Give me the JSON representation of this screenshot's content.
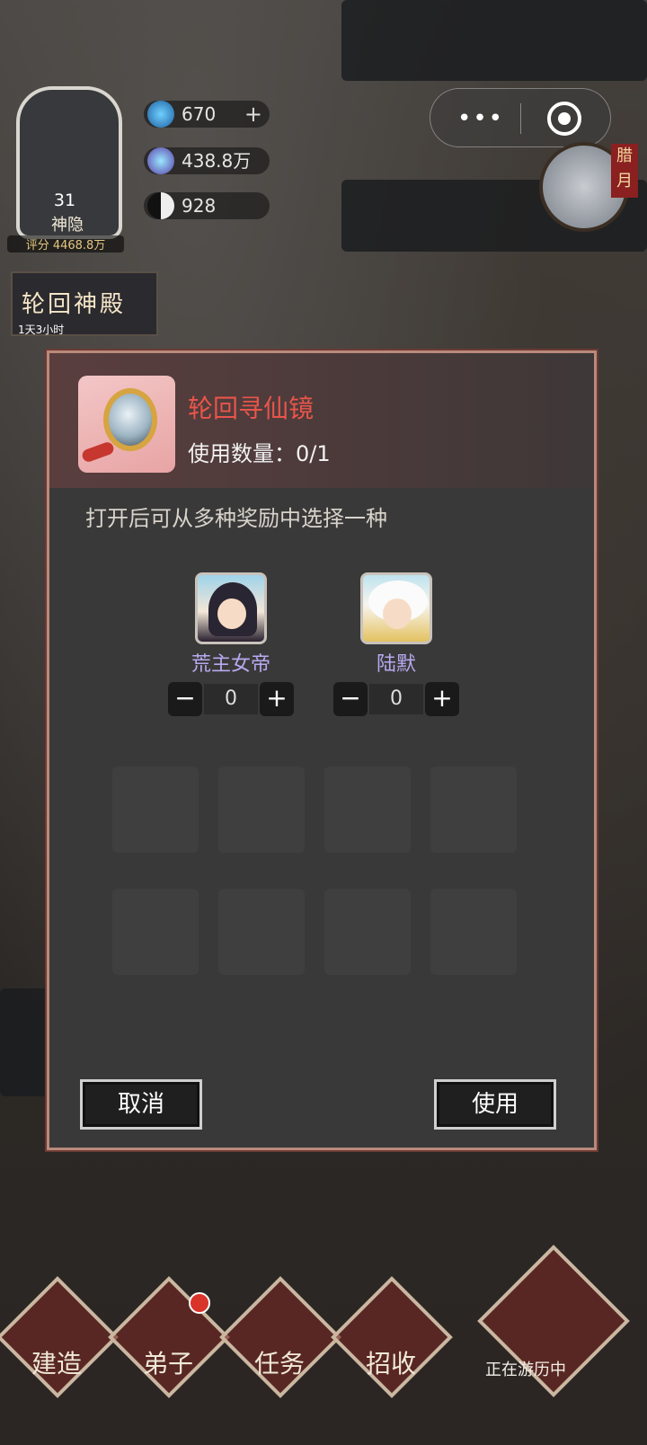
{
  "hud": {
    "avatar_level": "31",
    "avatar_name": "神隐",
    "avatar_score": "评分 4468.8万",
    "resources": [
      {
        "icon": "gem-icon",
        "value": "670",
        "has_plus": true
      },
      {
        "icon": "spirit-orb-icon",
        "value": "438.8万",
        "has_plus": false
      },
      {
        "icon": "yin-yang-icon",
        "value": "928",
        "has_plus": false
      }
    ],
    "hall_button_title": "轮回神殿",
    "hall_button_timer": "1天3小时",
    "month_tag": "腊月"
  },
  "dialog": {
    "item_name": "轮回寻仙镜",
    "use_count": "使用数量：0/1",
    "description": "打开后可从多种奖励中选择一种",
    "options": [
      {
        "name": "荒主女帝",
        "quantity": "0"
      },
      {
        "name": "陆默",
        "quantity": "0"
      }
    ],
    "stepper_minus": "−",
    "stepper_plus": "+",
    "cancel_label": "取消",
    "use_label": "使用"
  },
  "nav": {
    "items": [
      {
        "label": "建造",
        "badge": false
      },
      {
        "label": "弟子",
        "badge": true
      },
      {
        "label": "任务",
        "badge": false
      },
      {
        "label": "招收",
        "badge": false
      }
    ],
    "travel_status": "正在游历中"
  },
  "colors": {
    "item_name": "#e8554a",
    "option_name": "#b7aaf0",
    "dialog_bg": "#3a3939",
    "dialog_border": "#b98a7c"
  }
}
